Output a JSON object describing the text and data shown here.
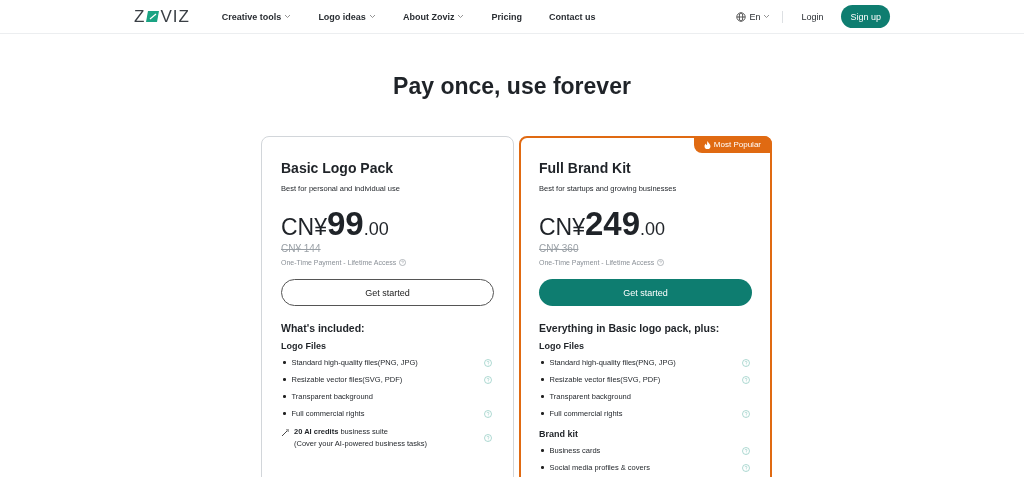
{
  "nav": {
    "logo": {
      "before": "Z",
      "after": "VIZ"
    },
    "items": [
      {
        "label": "Creative tools",
        "dropdown": true
      },
      {
        "label": "Logo ideas",
        "dropdown": true
      },
      {
        "label": "About Zoviz",
        "dropdown": true
      },
      {
        "label": "Pricing",
        "dropdown": false
      },
      {
        "label": "Contact us",
        "dropdown": false
      }
    ],
    "language": "En",
    "login": "Login",
    "signup": "Sign up"
  },
  "heading": "Pay once, use forever",
  "plans": [
    {
      "name": "Basic Logo Pack",
      "featured": false,
      "tagline": "Best for personal and individual use",
      "currency": "CN¥",
      "amount": "99",
      "cents": ".00",
      "old_price": "CN¥ 144",
      "note": "One-Time Payment - Lifetime Access",
      "button": "Get started",
      "includes": "What's included:",
      "groups": [
        {
          "title": "Logo Files",
          "items": [
            {
              "kind": "bullet",
              "text": "Standard high-quality files(PNG, JPG)",
              "help": true
            },
            {
              "kind": "bullet",
              "text": "Resizable vector files(SVG, PDF)",
              "help": true
            },
            {
              "kind": "bullet",
              "text": "Transparent background",
              "help": false
            },
            {
              "kind": "bullet",
              "text": "Full commercial rights",
              "help": true
            },
            {
              "kind": "credits",
              "text": "**20 AI credits** business suite",
              "subtext": "(Cover your AI-powered business tasks)",
              "help": true
            }
          ]
        }
      ]
    },
    {
      "name": "Full Brand Kit",
      "featured": true,
      "badge": "Most Popular",
      "tagline": "Best for startups and growing businesses",
      "currency": "CN¥",
      "amount": "249",
      "cents": ".00",
      "old_price": "CN¥ 360",
      "note": "One-Time Payment - Lifetime Access",
      "button": "Get started",
      "includes": "Everything in Basic logo pack, plus:",
      "groups": [
        {
          "title": "Logo Files",
          "items": [
            {
              "kind": "bullet",
              "text": "Standard high-quality files(PNG, JPG)",
              "help": true
            },
            {
              "kind": "bullet",
              "text": "Resizable vector files(SVG, PDF)",
              "help": true
            },
            {
              "kind": "bullet",
              "text": "Transparent background",
              "help": false
            },
            {
              "kind": "bullet",
              "text": "Full commercial rights",
              "help": true
            }
          ]
        },
        {
          "title": "Brand kit",
          "items": [
            {
              "kind": "bullet",
              "text": "Business cards",
              "help": true
            },
            {
              "kind": "bullet",
              "text": "Social media profiles & covers",
              "help": true
            }
          ]
        }
      ]
    }
  ]
}
